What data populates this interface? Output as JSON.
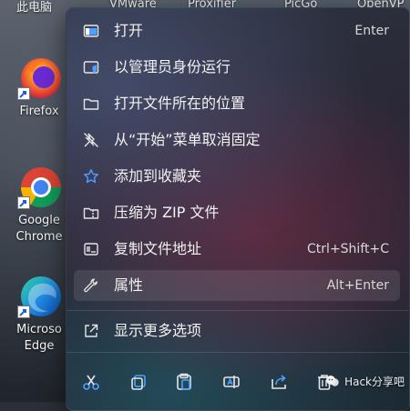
{
  "desktop": {
    "top_labels": [
      "此电脑",
      "VMware",
      "Proxifier",
      "PicGo",
      "OpenVP"
    ],
    "icons": [
      {
        "label": "Firefox",
        "icon": "firefox-icon"
      },
      {
        "label1": "Google",
        "label2": "Chrome",
        "icon": "chrome-icon"
      },
      {
        "label1": "Microso",
        "label2": "Edge",
        "icon": "edge-icon"
      }
    ]
  },
  "menu": {
    "items": [
      {
        "label": "打开",
        "shortcut": "Enter",
        "icon": "open-window-icon"
      },
      {
        "label": "以管理员身份运行",
        "shortcut": "",
        "icon": "admin-shield-icon"
      },
      {
        "label": "打开文件所在的位置",
        "shortcut": "",
        "icon": "folder-icon"
      },
      {
        "label": "从“开始”菜单取消固定",
        "shortcut": "",
        "icon": "unpin-icon"
      },
      {
        "label": "添加到收藏夹",
        "shortcut": "",
        "icon": "star-icon"
      },
      {
        "label": "压缩为 ZIP 文件",
        "shortcut": "",
        "icon": "zip-folder-icon"
      },
      {
        "label": "复制文件地址",
        "shortcut": "Ctrl+Shift+C",
        "icon": "copy-path-icon"
      },
      {
        "label": "属性",
        "shortcut": "Alt+Enter",
        "icon": "wrench-icon",
        "hovered": true
      },
      {
        "label": "显示更多选项",
        "shortcut": "",
        "icon": "more-options-icon"
      }
    ],
    "toolbar": [
      "cut-icon",
      "copy-icon",
      "paste-icon",
      "rename-icon",
      "share-icon",
      "delete-icon"
    ]
  },
  "watermark": {
    "text": "Hack分享吧",
    "icon": "wechat-icon"
  },
  "colors": {
    "accent_blue": "#4ea1ff",
    "icon_stroke": "#e6e6e6"
  }
}
